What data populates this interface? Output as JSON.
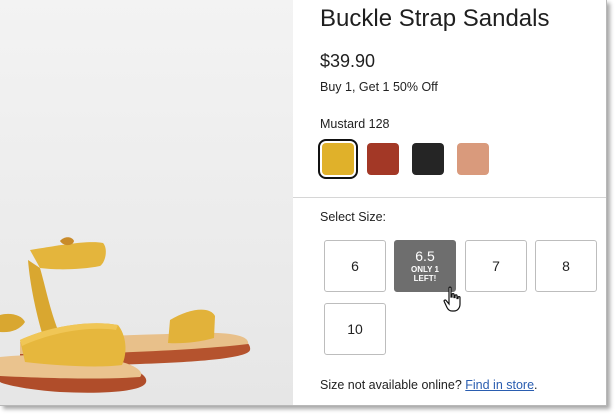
{
  "product": {
    "title": "Buckle Strap Sandals",
    "price": "$39.90",
    "promo": "Buy 1, Get 1 50% Off"
  },
  "color": {
    "label": "Mustard 128",
    "swatches": [
      {
        "name": "mustard",
        "hex": "#e0b12a",
        "selected": true
      },
      {
        "name": "rust",
        "hex": "#a33826",
        "selected": false
      },
      {
        "name": "black",
        "hex": "#252525",
        "selected": false
      },
      {
        "name": "blush",
        "hex": "#d99a7c",
        "selected": false
      }
    ]
  },
  "size": {
    "label": "Select Size:",
    "options": [
      {
        "value": "6",
        "note": ""
      },
      {
        "value": "6.5",
        "note": "ONLY 1 LEFT!",
        "active": true
      },
      {
        "value": "7",
        "note": ""
      },
      {
        "value": "8",
        "note": ""
      },
      {
        "value": "10",
        "note": ""
      }
    ]
  },
  "store": {
    "text": "Size not available online?",
    "link": "Find in store",
    "after": "."
  },
  "colors": {
    "accent_link": "#2a5db0",
    "active_size_bg": "#6e6e6e"
  },
  "image": {
    "subject": "mustard yellow buckle strap sandals"
  }
}
